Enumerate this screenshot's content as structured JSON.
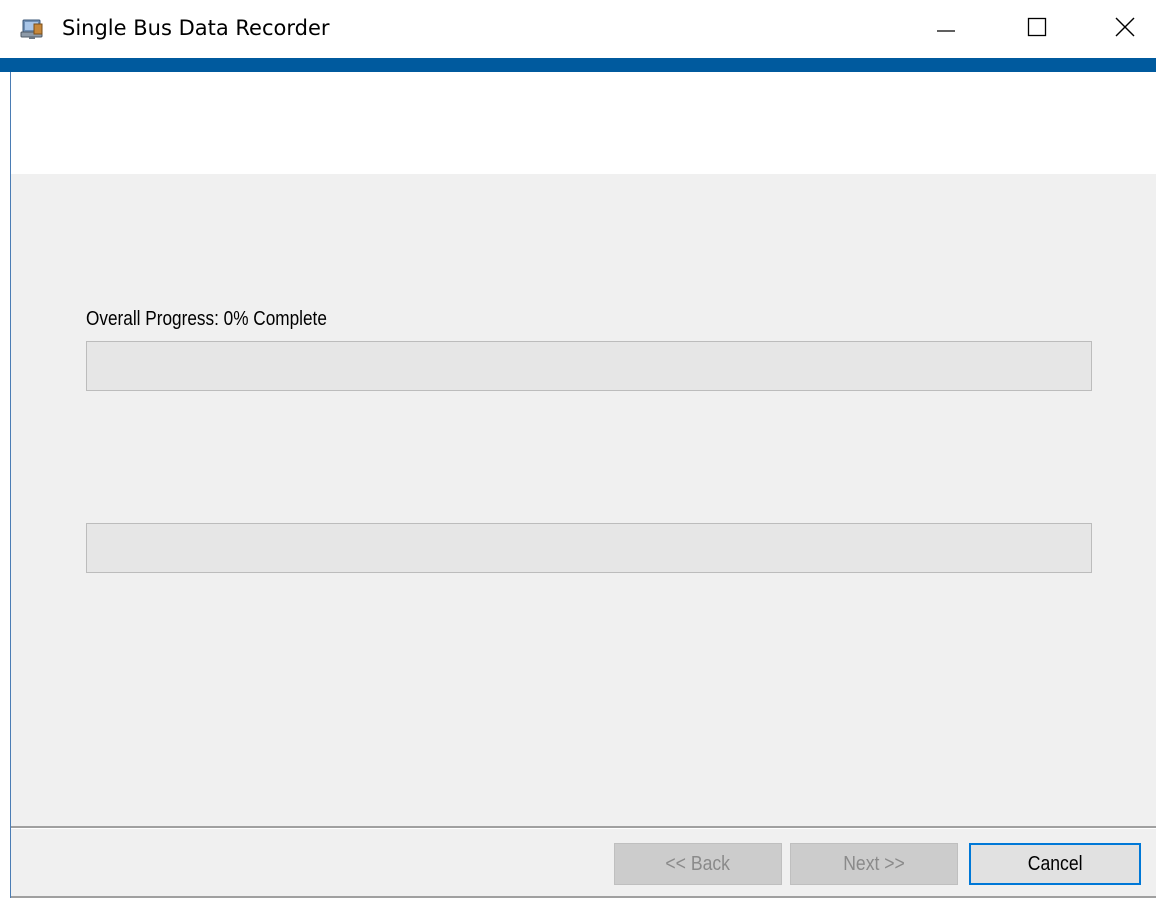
{
  "window": {
    "title": "Single Bus Data Recorder",
    "icon": "installer-computer-icon",
    "accent_color": "#005a9e"
  },
  "caption_buttons": {
    "minimize_icon": "minimize-icon",
    "maximize_icon": "maximize-icon",
    "close_icon": "close-icon"
  },
  "progress": {
    "overall_label": "Overall Progress: 0% Complete",
    "overall_value": 0,
    "secondary_value": 0
  },
  "footer": {
    "back_label": "<< Back",
    "next_label": "Next >>",
    "cancel_label": "Cancel",
    "back_enabled": false,
    "next_enabled": false,
    "cancel_enabled": true
  }
}
